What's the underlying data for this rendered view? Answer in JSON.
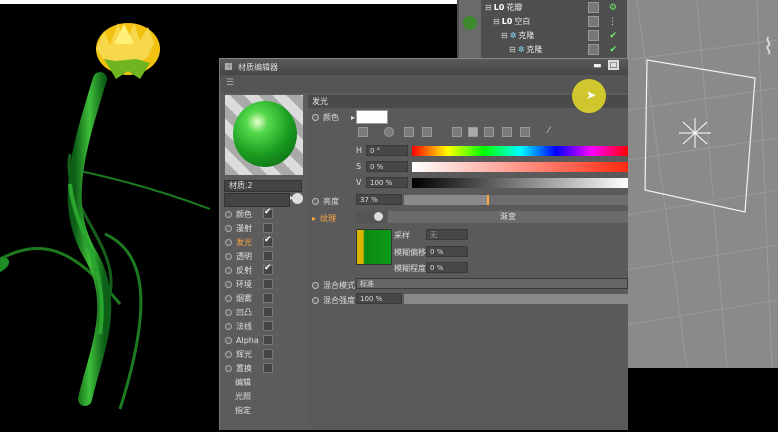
{
  "object_manager": {
    "rows": [
      {
        "label": "花瓣",
        "level": 0
      },
      {
        "label": "空白",
        "level": 1
      },
      {
        "label": "克隆",
        "level": 2
      },
      {
        "label": "克隆",
        "level": 3
      }
    ]
  },
  "material_editor": {
    "title": "材质编辑器",
    "material_name": "材质.2",
    "channels": [
      {
        "label": "颜色",
        "checked": true,
        "active": false
      },
      {
        "label": "漫射",
        "checked": false,
        "active": false
      },
      {
        "label": "发光",
        "checked": true,
        "active": true
      },
      {
        "label": "透明",
        "checked": false,
        "active": false
      },
      {
        "label": "反射",
        "checked": true,
        "active": false
      },
      {
        "label": "环境",
        "checked": false,
        "active": false
      },
      {
        "label": "烟雾",
        "checked": false,
        "active": false
      },
      {
        "label": "凹凸",
        "checked": false,
        "active": false
      },
      {
        "label": "法线",
        "checked": false,
        "active": false
      },
      {
        "label": "Alpha",
        "checked": false,
        "active": false
      },
      {
        "label": "辉光",
        "checked": false,
        "active": false
      },
      {
        "label": "置换",
        "checked": false,
        "active": false
      }
    ],
    "extra_items": [
      "编辑",
      "光照",
      "指定"
    ],
    "section_title": "发光",
    "color_label": "颜色",
    "h_label": "H",
    "h_value": "0 °",
    "s_label": "S",
    "s_value": "0 %",
    "v_label": "V",
    "v_value": "100 %",
    "brightness_label": "亮度",
    "brightness_value": "37 %",
    "brightness_fraction": 0.37,
    "texture_label": "纹理",
    "texture_value": "渐变",
    "sampling_label": "采样",
    "sampling_value": "无",
    "blur_offset_label": "模糊偏移",
    "blur_offset_value": "0 %",
    "blur_scale_label": "模糊程度",
    "blur_scale_value": "0 %",
    "mix_mode_label": "混合模式",
    "mix_mode_value": "标准",
    "mix_strength_label": "混合强度",
    "mix_strength_value": "100 %",
    "mix_strength_fraction": 1.0
  },
  "colors": {
    "accent": "#ffa640",
    "check": "#6cf06c"
  }
}
